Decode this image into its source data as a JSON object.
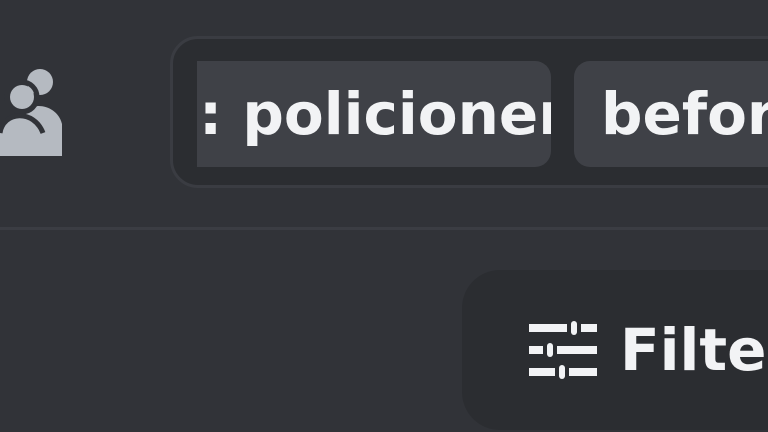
{
  "header": {
    "members_icon": "members-icon",
    "search_tokens": [
      {
        "label": ": policioner"
      },
      {
        "label": "before"
      }
    ]
  },
  "filter": {
    "icon": "sliders-icon",
    "label": "Filter"
  },
  "colors": {
    "background": "#313338",
    "input_background": "#2b2d31",
    "token_background": "#3f4147",
    "text": "#f2f3f5",
    "icon": "#b5bac1"
  }
}
